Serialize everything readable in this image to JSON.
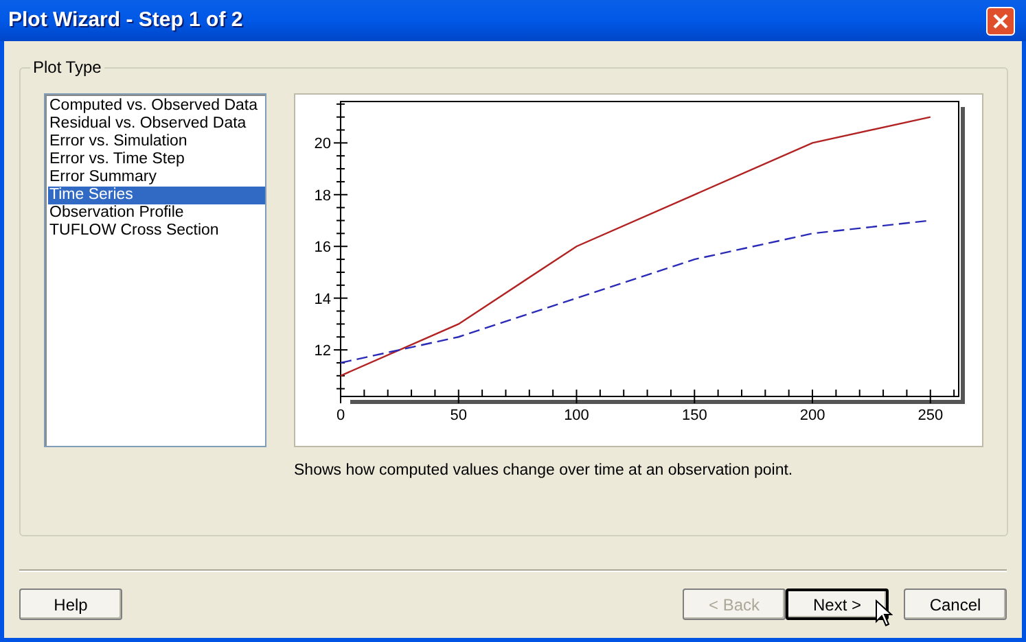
{
  "window": {
    "title": "Plot Wizard - Step 1 of 2"
  },
  "group": {
    "label": "Plot Type"
  },
  "plot_types": [
    {
      "label": "Computed vs. Observed Data",
      "selected": false
    },
    {
      "label": "Residual vs. Observed Data",
      "selected": false
    },
    {
      "label": "Error vs. Simulation",
      "selected": false
    },
    {
      "label": "Error vs. Time Step",
      "selected": false
    },
    {
      "label": "Error Summary",
      "selected": false
    },
    {
      "label": "Time Series",
      "selected": true
    },
    {
      "label": "Observation Profile",
      "selected": false
    },
    {
      "label": "TUFLOW Cross Section",
      "selected": false
    }
  ],
  "preview": {
    "chart_data": {
      "type": "line",
      "x": [
        0,
        50,
        100,
        150,
        200,
        250
      ],
      "series": [
        {
          "color": "#b22222",
          "line_style": "solid",
          "values": [
            11,
            13,
            16,
            18,
            20,
            21
          ]
        },
        {
          "color": "#2a2ab8",
          "line_style": "dashed",
          "values": [
            11.5,
            12.5,
            14,
            15.5,
            16.5,
            17
          ]
        }
      ],
      "xlim": [
        0,
        262
      ],
      "ylim": [
        10.2,
        21.6
      ],
      "xticks": [
        0,
        50,
        100,
        150,
        200,
        250
      ],
      "yticks": [
        12,
        14,
        16,
        18,
        20
      ]
    }
  },
  "description": "Shows how computed values change over time at an observation point.",
  "buttons": [
    {
      "label": "Help",
      "disabled": false,
      "focused": false
    },
    {
      "label": "< Back",
      "disabled": true,
      "focused": false
    },
    {
      "label": "Next >",
      "disabled": false,
      "focused": true
    },
    {
      "label": "Cancel",
      "disabled": false,
      "focused": false
    }
  ]
}
